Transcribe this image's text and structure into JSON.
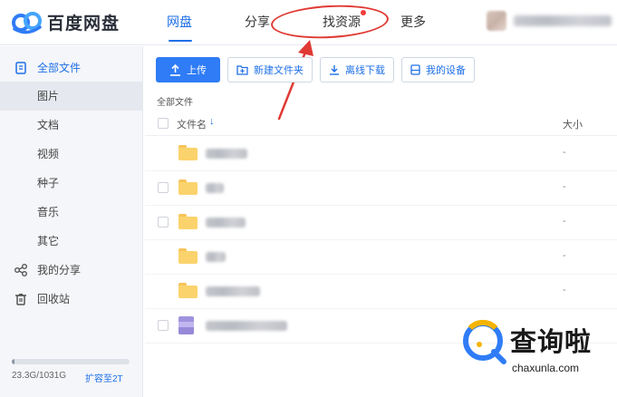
{
  "app": {
    "logo_text": "百度网盘",
    "colors": {
      "accent": "#1e6fe7",
      "primary_button": "#2f7cf6",
      "annotation": "#e03a34",
      "folder": "#fbd36c"
    }
  },
  "nav": {
    "items": [
      {
        "label": "网盘",
        "active": true
      },
      {
        "label": "分享",
        "active": false
      },
      {
        "label": "找资源",
        "active": false,
        "badge_dot": true
      },
      {
        "label": "更多",
        "active": false
      }
    ]
  },
  "sidebar": {
    "items": [
      {
        "label": "全部文件",
        "icon": "all-files-icon"
      },
      {
        "label": "图片"
      },
      {
        "label": "文档"
      },
      {
        "label": "视频"
      },
      {
        "label": "种子"
      },
      {
        "label": "音乐"
      },
      {
        "label": "其它"
      },
      {
        "label": "我的分享",
        "icon": "share-icon"
      },
      {
        "label": "回收站",
        "icon": "trash-icon"
      }
    ],
    "quota": {
      "text": "23.3G/1031G",
      "used_fraction": 0.023,
      "expand_label": "扩容至2T"
    }
  },
  "toolbar": {
    "upload_label": "上传",
    "new_folder_label": "新建文件夹",
    "offline_download_label": "离线下载",
    "my_devices_label": "我的设备"
  },
  "breadcrumb": "全部文件",
  "table": {
    "col_name": "文件名",
    "sort_arrow": "↓",
    "col_size": "大小",
    "rows": [
      {
        "type": "folder",
        "size": "-"
      },
      {
        "type": "folder",
        "size": "-"
      },
      {
        "type": "folder",
        "size": "-"
      },
      {
        "type": "folder",
        "size": "-"
      },
      {
        "type": "folder",
        "size": "-"
      },
      {
        "type": "file",
        "size": ""
      }
    ]
  },
  "watermark": {
    "text": "查询啦",
    "url": "chaxunla.com"
  }
}
